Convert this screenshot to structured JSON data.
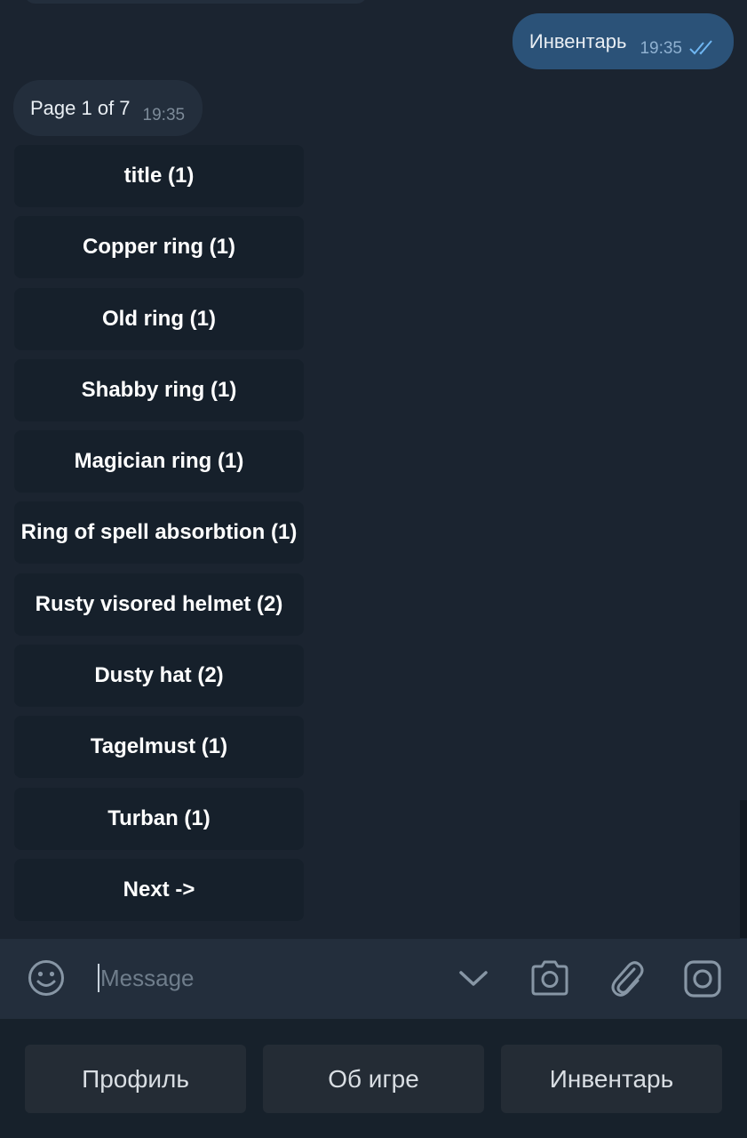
{
  "outgoing_message": {
    "text": "Инвентарь",
    "time": "19:35"
  },
  "incoming_message": {
    "text": "Page 1 of 7",
    "time": "19:35"
  },
  "inline_keyboard": [
    "title (1)",
    "Copper ring (1)",
    "Old ring (1)",
    "Shabby ring (1)",
    "Magician ring (1)",
    "Ring of spell absorbtion (1)",
    "Rusty visored helmet (2)",
    "Dusty hat (2)",
    "Tagelmust (1)",
    "Turban (1)",
    "Next ->"
  ],
  "input": {
    "placeholder": "Message",
    "value": ""
  },
  "icons": {
    "emoji": "emoji-icon",
    "expand": "chevron-down-icon",
    "camera": "camera-icon",
    "attach": "paperclip-icon",
    "instagram": "instagram-icon"
  },
  "reply_keyboard": [
    "Профиль",
    "Об игре",
    "Инвентарь"
  ],
  "colors": {
    "background": "#1b2430",
    "outgoing_bubble": "#2b5278",
    "incoming_bubble": "#232e3c",
    "inline_button": "#16202b",
    "reply_button": "#242c35"
  }
}
